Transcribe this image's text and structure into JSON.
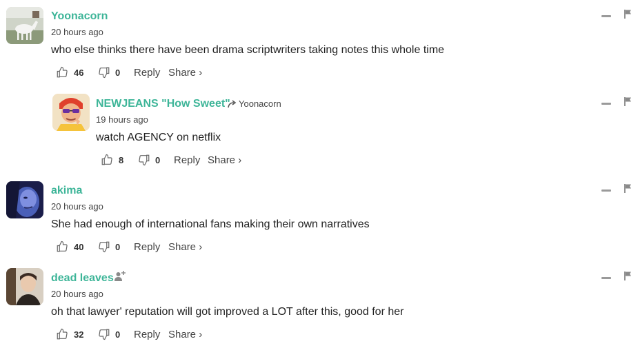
{
  "comments": [
    {
      "username": "Yoonacorn",
      "time": "20 hours ago",
      "text": "who else thinks there have been drama scriptwriters taking notes this whole time",
      "likes": "46",
      "dislikes": "0",
      "reply_label": "Reply",
      "share_label": "Share ›",
      "avatar_icon": "white-horse-avatar"
    },
    {
      "username": "NEWJEANS \"How Sweet\"",
      "reply_to": "Yoonacorn",
      "time": "19 hours ago",
      "text": "watch AGENCY on netflix",
      "likes": "8",
      "dislikes": "0",
      "reply_label": "Reply",
      "share_label": "Share ›",
      "avatar_icon": "cartoon-character-avatar"
    },
    {
      "username": "akima",
      "time": "20 hours ago",
      "text": "She had enough of international fans making their own narratives",
      "likes": "40",
      "dislikes": "0",
      "reply_label": "Reply",
      "share_label": "Share ›",
      "avatar_icon": "blue-face-avatar"
    },
    {
      "username": "dead leaves",
      "time": "20 hours ago",
      "text": "oh that lawyer' reputation will got improved a LOT after this, good for her",
      "likes": "32",
      "dislikes": "0",
      "reply_label": "Reply",
      "share_label": "Share ›",
      "avatar_icon": "person-photo-avatar"
    }
  ],
  "colors": {
    "username": "#3db598",
    "text": "#222222",
    "muted": "#444444",
    "icon": "#9a9a9a"
  }
}
